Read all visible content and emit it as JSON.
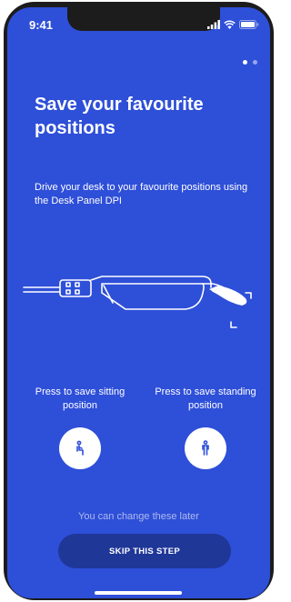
{
  "status_bar": {
    "time": "9:41",
    "icons": [
      "signal-icon",
      "wifi-icon",
      "battery-icon"
    ]
  },
  "pagination": {
    "current": 1,
    "total": 2
  },
  "onboarding": {
    "title": "Save your favourite positions",
    "subtitle": "Drive your desk to your favourite positions using the Desk Panel DPI"
  },
  "save_buttons": {
    "sitting": {
      "label": "Press to save sitting position",
      "icon": "sitting-person-icon"
    },
    "standing": {
      "label": "Press to save standing position",
      "icon": "standing-person-icon"
    }
  },
  "footer": {
    "note": "You can change these later",
    "skip_label": "SKIP THIS STEP"
  },
  "colors": {
    "background": "#2e4fd8",
    "skip_button": "#1f3797",
    "text": "#ffffff",
    "icon": "#2e4fd8"
  }
}
